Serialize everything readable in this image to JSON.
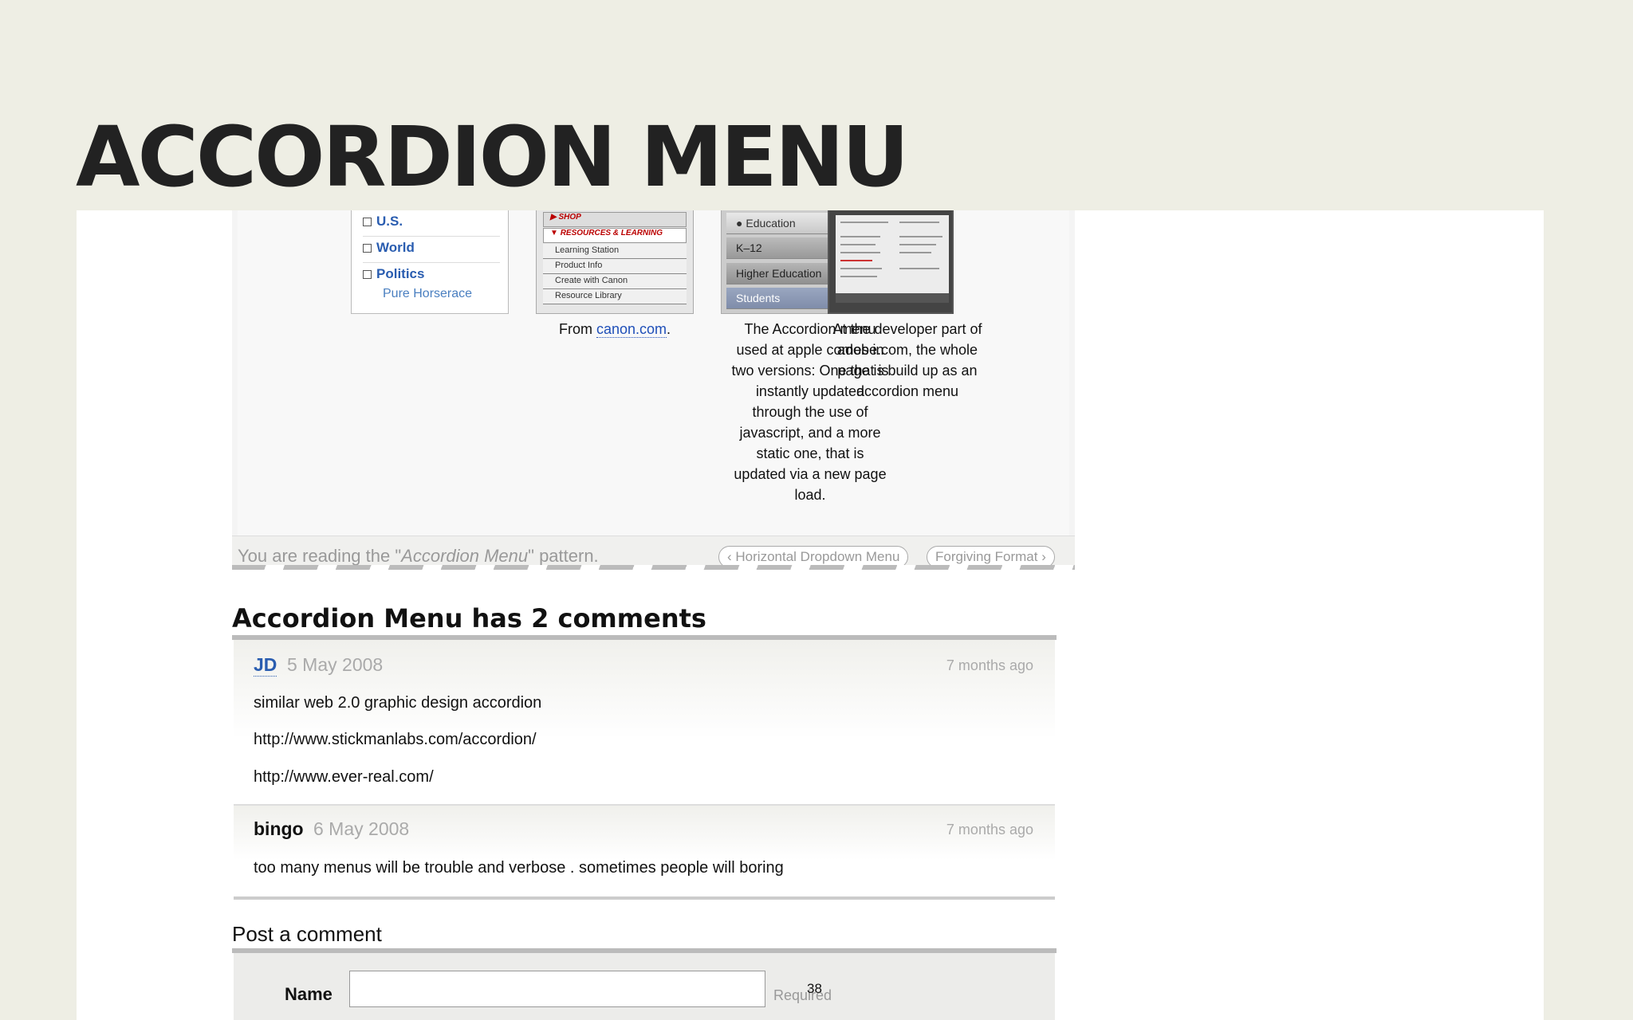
{
  "slide": {
    "title": "ACCORDION MENU",
    "page_number": "38"
  },
  "examples": {
    "nyt": {
      "items": [
        "U.S.",
        "World",
        "Politics"
      ],
      "subitem": "Pure Horserace"
    },
    "canon": {
      "headers": [
        "SHOP",
        "RESOURCES & LEARNING"
      ],
      "items": [
        "Learning Station",
        "Product Info",
        "Create with Canon",
        "Resource Library"
      ],
      "caption_prefix": "From ",
      "caption_link": "canon.com",
      "caption_suffix": "."
    },
    "apple": {
      "items": [
        "Education",
        "K–12",
        "Higher Education",
        "Students"
      ],
      "caption_lines": [
        "The Accordion menu",
        "used at apple comes in",
        "two versions: One that is",
        "instantly updated",
        "through the use of",
        "javascript, and a more",
        "static one, that is",
        "updated via a new page",
        "load."
      ]
    },
    "adobe": {
      "caption_lines": [
        "At the developer part of",
        "adobe.com, the whole",
        "page is build up as an",
        "accordion menu"
      ]
    }
  },
  "reading": {
    "prefix": "You are reading the \"",
    "pattern": "Accordion Menu",
    "suffix": "\" pattern.",
    "prev_label": "Horizontal Dropdown Menu",
    "next_label": "Forgiving Format"
  },
  "comments": {
    "heading": "Accordion Menu has 2 comments",
    "items": [
      {
        "author": "JD",
        "date": "5 May 2008",
        "ago": "7 months ago",
        "lines": [
          "similar web 2.0 graphic design accordion",
          "http://www.stickmanlabs.com/accordion/",
          "http://www.ever-real.com/"
        ]
      },
      {
        "author": "bingo",
        "date": "6 May 2008",
        "ago": "7 months ago",
        "lines": [
          "too many menus will be trouble and verbose . sometimes people will boring"
        ]
      }
    ]
  },
  "post_comment": {
    "heading": "Post a comment",
    "name_label": "Name",
    "name_value": "",
    "required_label": "Required"
  }
}
